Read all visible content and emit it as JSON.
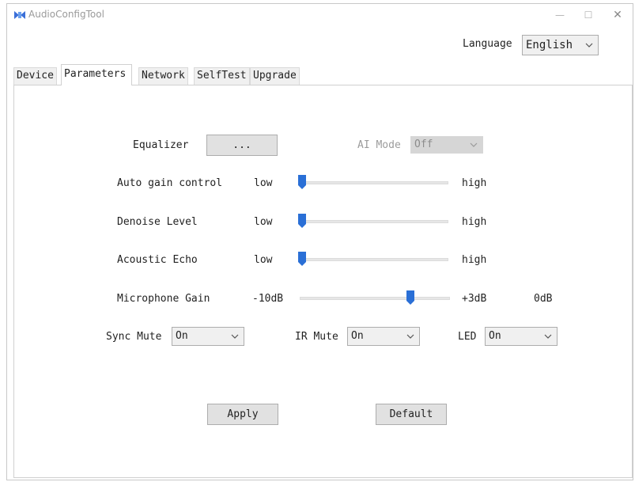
{
  "window": {
    "title": "AudioConfigTool",
    "minimize_icon": "minimize-icon",
    "maximize_icon": "maximize-icon",
    "close_icon": "close-icon",
    "minimize_glyph": "—",
    "maximize_glyph": "☐",
    "close_glyph": "✕"
  },
  "language": {
    "label": "Language",
    "value": "English"
  },
  "tabs": [
    {
      "label": "Device",
      "active": false
    },
    {
      "label": "Parameters",
      "active": true
    },
    {
      "label": "Network",
      "active": false
    },
    {
      "label": "SelfTest",
      "active": false
    },
    {
      "label": "Upgrade",
      "active": false
    }
  ],
  "parameters": {
    "equalizer": {
      "label": "Equalizer",
      "button": "..."
    },
    "ai_mode": {
      "label": "AI Mode",
      "value": "Off",
      "enabled": false
    },
    "sliders": [
      {
        "label": "Auto gain control",
        "min_label": "low",
        "max_label": "high",
        "value": 0
      },
      {
        "label": "Denoise Level",
        "min_label": "low",
        "max_label": "high",
        "value": 0
      },
      {
        "label": "Acoustic Echo",
        "min_label": "low",
        "max_label": "high",
        "value": 0
      },
      {
        "label": "Microphone Gain",
        "min_label": "-10dB",
        "max_label": "+3dB",
        "value": 0.75,
        "readout": "0dB"
      }
    ],
    "sync_mute": {
      "label": "Sync Mute",
      "value": "On"
    },
    "ir_mute": {
      "label": "IR Mute",
      "value": "On"
    },
    "led": {
      "label": "LED",
      "value": "On"
    },
    "apply_button": "Apply",
    "default_button": "Default"
  },
  "colors": {
    "accent": "#2a6fd6",
    "icon": "#3b6fd8"
  }
}
